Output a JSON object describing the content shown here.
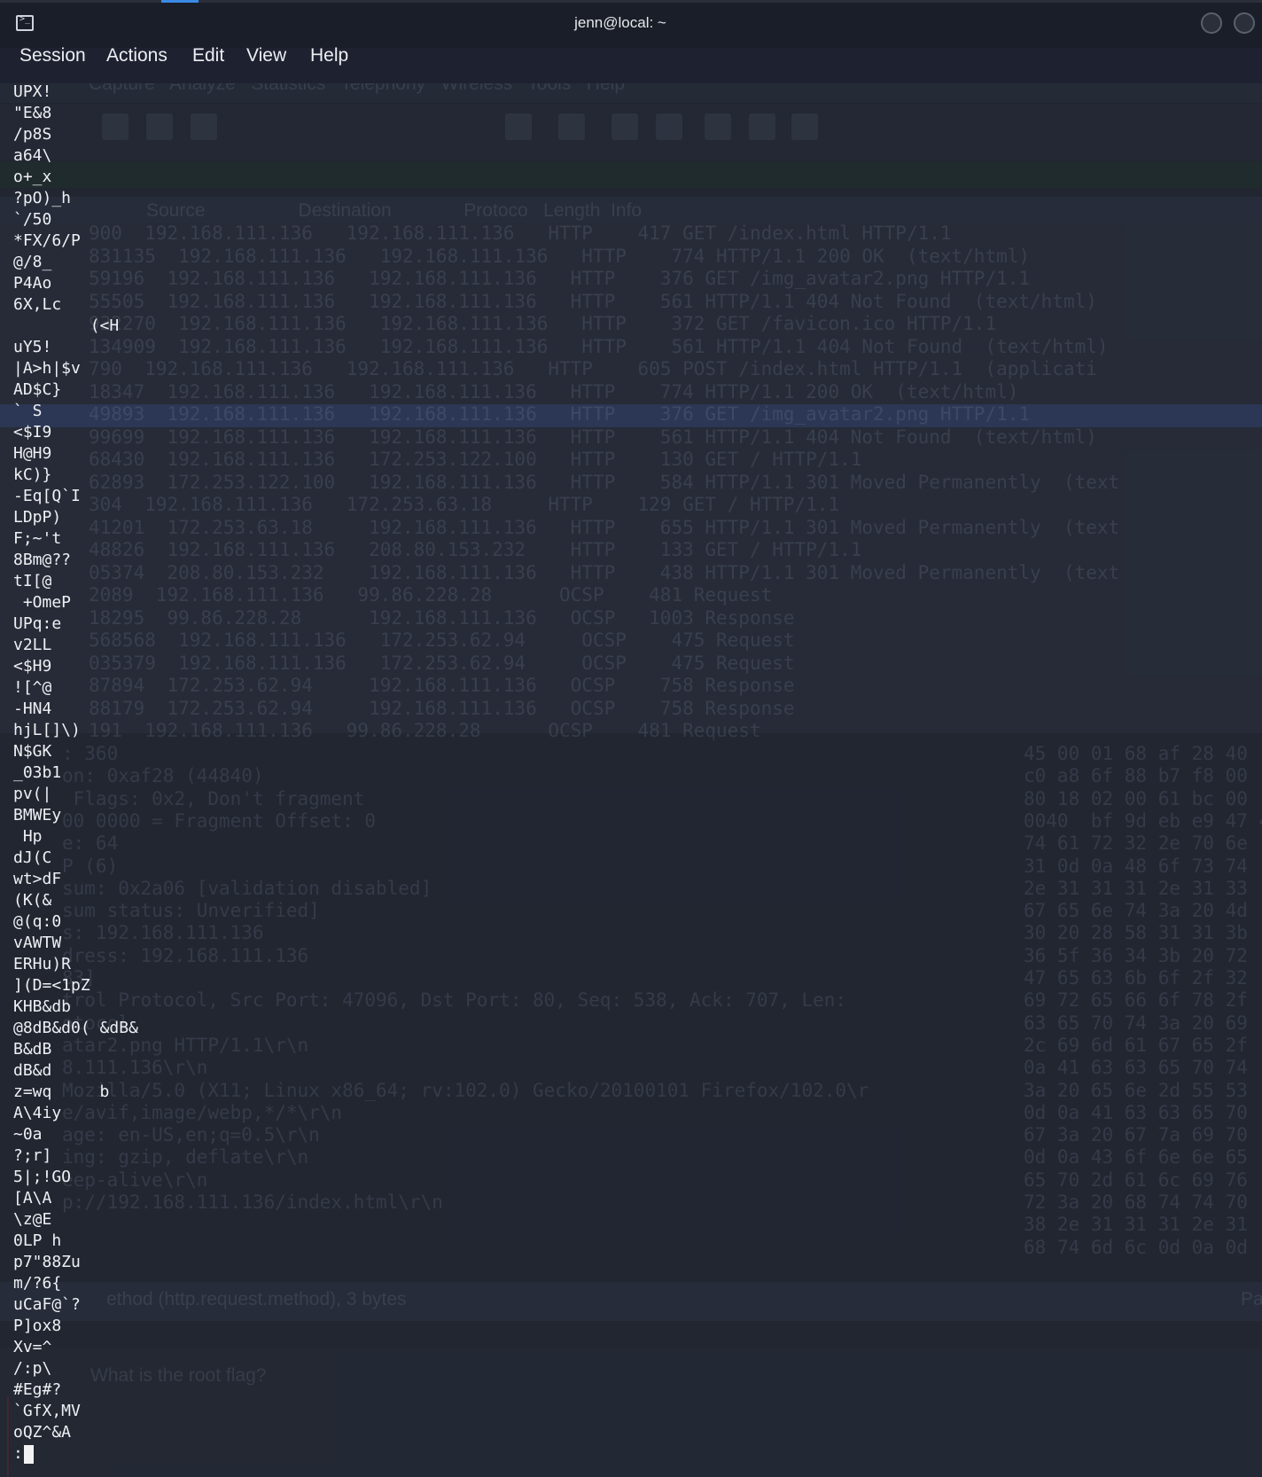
{
  "window": {
    "title": "jenn@local: ~"
  },
  "menu": {
    "items": [
      "Session",
      "Actions",
      "Edit",
      "View",
      "Help"
    ]
  },
  "background_app": {
    "menu": "Capture   Analyze   Statistics   Telephony   Wireless   Tools   Help",
    "columns": "Source                  Destination              Protoco   Length  Info",
    "packets": [
      "900  192.168.111.136   192.168.111.136   HTTP    417 GET /index.html HTTP/1.1",
      "831135  192.168.111.136   192.168.111.136   HTTP    774 HTTP/1.1 200 OK  (text/html)",
      "59196  192.168.111.136   192.168.111.136   HTTP    376 GET /img_avatar2.png HTTP/1.1",
      "55505  192.168.111.136   192.168.111.136   HTTP    561 HTTP/1.1 404 Not Found  (text/html)",
      "932270  192.168.111.136   192.168.111.136   HTTP    372 GET /favicon.ico HTTP/1.1",
      "134909  192.168.111.136   192.168.111.136   HTTP    561 HTTP/1.1 404 Not Found  (text/html)",
      "790  192.168.111.136   192.168.111.136   HTTP    605 POST /index.html HTTP/1.1  (applicati",
      "18347  192.168.111.136   192.168.111.136   HTTP    774 HTTP/1.1 200 OK  (text/html)",
      "49893  192.168.111.136   192.168.111.136   HTTP    376 GET /img_avatar2.png HTTP/1.1",
      "99699  192.168.111.136   192.168.111.136   HTTP    561 HTTP/1.1 404 Not Found  (text/html)",
      "68430  192.168.111.136   172.253.122.100   HTTP    130 GET / HTTP/1.1",
      "62893  172.253.122.100   192.168.111.136   HTTP    584 HTTP/1.1 301 Moved Permanently  (text",
      "304  192.168.111.136   172.253.63.18     HTTP    129 GET / HTTP/1.1",
      "41201  172.253.63.18     192.168.111.136   HTTP    655 HTTP/1.1 301 Moved Permanently  (text",
      "48826  192.168.111.136   208.80.153.232    HTTP    133 GET / HTTP/1.1",
      "05374  208.80.153.232    192.168.111.136   HTTP    438 HTTP/1.1 301 Moved Permanently  (text",
      "2089  192.168.111.136   99.86.228.28      OCSP    481 Request",
      "18295  99.86.228.28      192.168.111.136   OCSP   1003 Response",
      "568568  192.168.111.136   172.253.62.94     OCSP    475 Request",
      "035379  192.168.111.136   172.253.62.94     OCSP    475 Request",
      "87894  172.253.62.94     192.168.111.136   OCSP    758 Response",
      "88179  172.253.62.94     192.168.111.136   OCSP    758 Response",
      "191  192.168.111.136   99.86.228.28      OCSP    481 Request"
    ],
    "details": [
      ": 360",
      "on: 0xaf28 (44840)",
      " Flags: 0x2, Don't fragment",
      "00 0000 = Fragment Offset: 0",
      "e: 64",
      "P (6)",
      "sum: 0x2a06 [validation disabled]",
      "sum status: Unverified]",
      "s: 192.168.111.136",
      "dress: 192.168.111.136",
      "83]",
      "trol Protocol, Src Port: 47096, Dst Port: 80, Seq: 538, Ack: 707, Len:",
      "otocol",
      "atar2.png HTTP/1.1\\r\\n",
      "8.111.136\\r\\n",
      "Mozilla/5.0 (X11; Linux x86_64; rv:102.0) Gecko/20100101 Firefox/102.0\\r",
      "e/avif,image/webp,*/*\\r\\n",
      "age: en-US,en;q=0.5\\r\\n",
      "ing: gzip, deflate\\r\\n",
      "eep-alive\\r\\n",
      "p://192.168.111.136/index.html\\r\\n"
    ],
    "bytes": [
      "45 00 01 68 af 28 40",
      "c0 a8 6f 88 b7 f8 00",
      "80 18 02 00 61 bc 00",
      "0040  bf 9d eb e9 47 45 54",
      "74 61 72 32 2e 70 6e",
      "31 0d 0a 48 6f 73 74",
      "2e 31 31 31 2e 31 33",
      "67 65 6e 74 3a 20 4d",
      "30 20 28 58 31 31 3b",
      "36 5f 36 34 3b 20 72",
      "47 65 63 6b 6f 2f 32",
      "69 72 65 66 6f 78 2f",
      "63 65 70 74 3a 20 69",
      "2c 69 6d 61 67 65 2f",
      "0a 41 63 63 65 70 74",
      "3a 20 65 6e 2d 55 53",
      "0d 0a 41 63 63 65 70",
      "67 3a 20 67 7a 69 70",
      "0d 0a 43 6f 6e 6e 65",
      "65 70 2d 61 6c 69 76",
      "72 3a 20 68 74 74 70",
      "38 2e 31 31 31 2e 31",
      "68 74 6d 6c 0d 0a 0d"
    ],
    "status_text": "ethod (http.request.method), 3 bytes",
    "status_right": "Pa",
    "question": "What is the root flag?"
  },
  "terminal": {
    "lines": [
      "UPX!",
      "\"E&8",
      "/p8S",
      "a64\\",
      "o+_x",
      "?pO)_h",
      "`/50",
      "*FX/6/P",
      "@/8_",
      "P4Ao",
      "6X,Lc",
      "        (<H",
      "uY5!",
      "|A>h|$v",
      "AD$C}",
      "` S",
      "<$I9",
      "H@H9",
      "kC)}",
      "-Eq[Q`I",
      "LDpP)",
      "F;~'t",
      "8Bm@??",
      "tI[@",
      " +OmeP",
      "UPq:e",
      "v2LL",
      "<$H9",
      "![^@",
      "-HN4",
      "hjL[]\\)",
      "N$GK",
      "_03b1",
      "pv(|",
      "BMWEy",
      " Hp",
      "dJ(C",
      "wt>dF",
      "(K(&",
      "@(q:0",
      "vAWTW",
      "ERHu)R",
      "](D=<1pZ",
      "KHB&db",
      "@8dB&d0( &dB&",
      "B&dB",
      "dB&d",
      "z=wq     b",
      "A\\4iy",
      "~0a",
      "?;r]",
      "5|;!GO",
      "[A\\A",
      "\\z@E",
      "0LP h",
      "p7\"88Zu",
      "m/?6{",
      "uCaF@`?",
      "P]ox8",
      "Xv=^",
      "/:p\\",
      "#Eg#?",
      "`GfX,MV",
      "oQZ^&A"
    ],
    "prompt": ":"
  }
}
